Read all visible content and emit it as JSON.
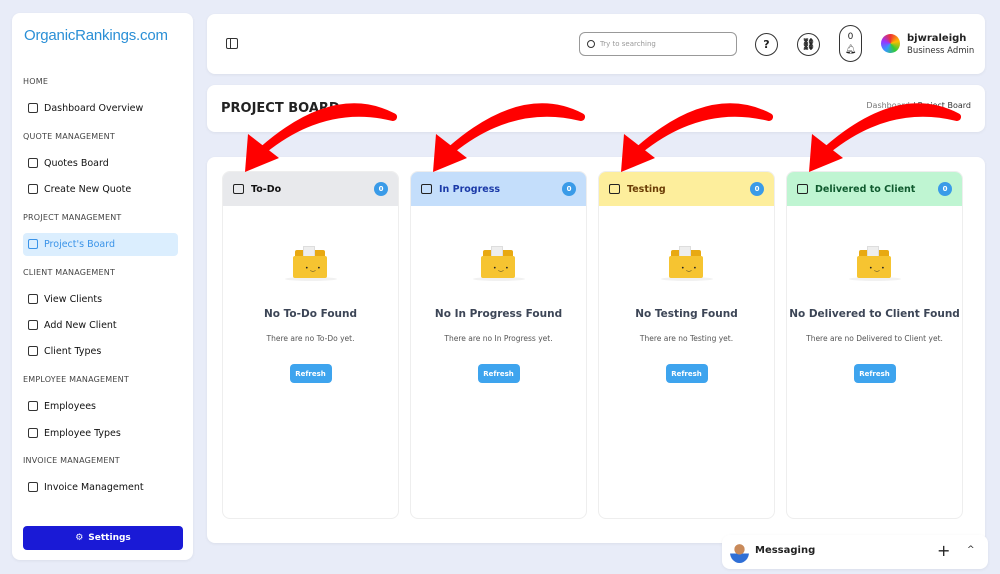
{
  "sidebar": {
    "logo": "OrganicRankings.com",
    "sections": [
      {
        "label": "HOME",
        "items": [
          {
            "label": "Dashboard Overview",
            "icon": "grid-icon"
          }
        ]
      },
      {
        "label": "QUOTE MANAGEMENT",
        "items": [
          {
            "label": "Quotes Board",
            "icon": "clipboard-icon"
          },
          {
            "label": "Create New Quote",
            "icon": "database-icon"
          }
        ]
      },
      {
        "label": "PROJECT MANAGEMENT",
        "items": [
          {
            "label": "Project's Board",
            "icon": "calendar-check-icon",
            "active": true
          }
        ]
      },
      {
        "label": "CLIENT MANAGEMENT",
        "items": [
          {
            "label": "View Clients",
            "icon": "user-icon"
          },
          {
            "label": "Add New Client",
            "icon": "user-plus-icon"
          },
          {
            "label": "Client Types",
            "icon": "users-icon"
          }
        ]
      },
      {
        "label": "EMPLOYEE MANAGEMENT",
        "items": [
          {
            "label": "Employees",
            "icon": "person-icon"
          },
          {
            "label": "Employee Types",
            "icon": "person-badge-icon"
          }
        ]
      },
      {
        "label": "INVOICE MANAGEMENT",
        "items": [
          {
            "label": "Invoice Management",
            "icon": "invoice-icon"
          }
        ]
      }
    ],
    "settings": "Settings"
  },
  "header": {
    "search_placeholder": "Try to searching",
    "notifications": "0",
    "user": {
      "name": "bjwraleigh",
      "role": "Business Admin"
    }
  },
  "page": {
    "title": "PROJECT BOARD",
    "breadcrumb": [
      "Dashboard",
      "Project Board"
    ]
  },
  "columns": [
    {
      "title": "To-Do",
      "count": "0",
      "color": "#e8e9ec",
      "text": "#111111",
      "empty_title": "No To-Do Found",
      "empty_text": "There are no To-Do yet.",
      "button": "Refresh"
    },
    {
      "title": "In Progress",
      "count": "0",
      "color": "#c4defb",
      "text": "#1b3aa8",
      "empty_title": "No In Progress Found",
      "empty_text": "There are no In Progress yet.",
      "button": "Refresh"
    },
    {
      "title": "Testing",
      "count": "0",
      "color": "#fdee9c",
      "text": "#6b3d06",
      "empty_title": "No Testing Found",
      "empty_text": "There are no Testing yet.",
      "button": "Refresh"
    },
    {
      "title": "Delivered to Client",
      "count": "0",
      "color": "#bff5d2",
      "text": "#0f5a2e",
      "empty_title": "No Delivered to Client Found",
      "empty_text": "There are no Delivered to Client yet.",
      "button": "Refresh"
    }
  ],
  "messaging": {
    "label": "Messaging"
  },
  "colors": {
    "accent": "#1a1ad6",
    "annotation_arrow": "#ff0000"
  }
}
